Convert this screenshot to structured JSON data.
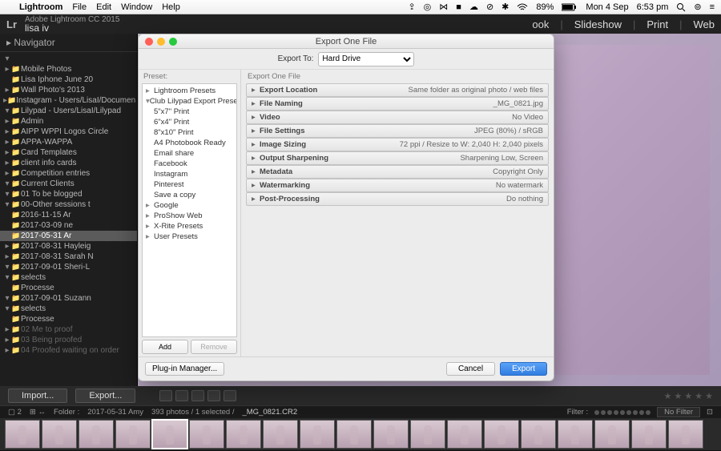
{
  "menubar": {
    "apple": "",
    "app": "Lightroom",
    "items": [
      "File",
      "Edit",
      "Window",
      "Help"
    ],
    "right": {
      "icons": [
        "⇪",
        "◎",
        "⋈",
        "■",
        "☁",
        "⊘",
        "✱",
        "⋮",
        "ᚼ"
      ],
      "wifi": "",
      "battery_pct": "89%",
      "day": "Mon 4 Sep",
      "time": "6:53 pm"
    }
  },
  "lr": {
    "version": "Adobe Lightroom CC 2015",
    "user": "lisa iv",
    "logo": "Lr",
    "modules": [
      "ook",
      "Slideshow",
      "Print",
      "Web"
    ]
  },
  "navigator_label": "Navigator",
  "tree": [
    {
      "ind": 1,
      "tri": "▾",
      "fold": "",
      "label": "",
      "dim": true
    },
    {
      "ind": 2,
      "tri": "▸",
      "fold": "📁",
      "label": "Mobile Photos"
    },
    {
      "ind": 3,
      "tri": "",
      "fold": "📁",
      "label": "Lisa Iphone June 20"
    },
    {
      "ind": 2,
      "tri": "▸",
      "fold": "📁",
      "label": "Wall Photo's 2013"
    },
    {
      "ind": 1,
      "tri": "▸",
      "fold": "📁",
      "label": "Instagram - Users/LisaI/Documen"
    },
    {
      "ind": 1,
      "tri": "▾",
      "fold": "📁",
      "label": "Lilypad - Users/LisaI/Lilypad"
    },
    {
      "ind": 2,
      "tri": "▸",
      "fold": "📁",
      "label": "Admin"
    },
    {
      "ind": 2,
      "tri": "▸",
      "fold": "📁",
      "label": "AIPP WPPI Logos Circle"
    },
    {
      "ind": 2,
      "tri": "▸",
      "fold": "📁",
      "label": "APPA-WAPPA"
    },
    {
      "ind": 2,
      "tri": "▸",
      "fold": "📁",
      "label": "Card Templates"
    },
    {
      "ind": 2,
      "tri": "▸",
      "fold": "📁",
      "label": "client info cards"
    },
    {
      "ind": 2,
      "tri": "▸",
      "fold": "📁",
      "label": "Competition entries"
    },
    {
      "ind": 2,
      "tri": "▾",
      "fold": "📁",
      "label": "Current Clients"
    },
    {
      "ind": 3,
      "tri": "▾",
      "fold": "📁",
      "label": "01 To be blogged"
    },
    {
      "ind": 4,
      "tri": "▾",
      "fold": "📁",
      "label": "00-Other sessions t"
    },
    {
      "ind": 5,
      "tri": "",
      "fold": "📁",
      "label": "2016-11-15 Ar"
    },
    {
      "ind": 5,
      "tri": "",
      "fold": "📁",
      "label": "2017-03-09 ne"
    },
    {
      "ind": 5,
      "tri": "",
      "fold": "📁",
      "label": "2017-05-31 Ar",
      "sel": true
    },
    {
      "ind": 4,
      "tri": "▸",
      "fold": "📁",
      "label": "2017-08-31 Hayleig"
    },
    {
      "ind": 4,
      "tri": "▸",
      "fold": "📁",
      "label": "2017-08-31 Sarah N"
    },
    {
      "ind": 4,
      "tri": "▾",
      "fold": "📁",
      "label": "2017-09-01 Sheri-L"
    },
    {
      "ind": 5,
      "tri": "▾",
      "fold": "📁",
      "label": "selects"
    },
    {
      "ind": 6,
      "tri": "",
      "fold": "📁",
      "label": "Processe"
    },
    {
      "ind": 4,
      "tri": "▾",
      "fold": "📁",
      "label": "2017-09-01 Suzann"
    },
    {
      "ind": 5,
      "tri": "▾",
      "fold": "📁",
      "label": "selects"
    },
    {
      "ind": 6,
      "tri": "",
      "fold": "📁",
      "label": "Processe"
    },
    {
      "ind": 3,
      "tri": "▸",
      "fold": "📁",
      "label": "02 Me to proof",
      "dim": true
    },
    {
      "ind": 3,
      "tri": "▸",
      "fold": "📁",
      "label": "03 Being proofed",
      "dim": true
    },
    {
      "ind": 3,
      "tri": "▸",
      "fold": "📁",
      "label": "04 Proofed waiting on order",
      "dim": true
    }
  ],
  "bottom": {
    "import": "Import...",
    "export": "Export..."
  },
  "pathbar": {
    "folder_label": "Folder :",
    "folder": "2017-05-31 Amy",
    "count": "393 photos / 1 selected /",
    "file": "_MG_0821.CR2",
    "filter_label": "Filter :",
    "nofilter": "No Filter"
  },
  "dialog": {
    "title": "Export One File",
    "export_to_label": "Export To:",
    "export_to_value": "Hard Drive",
    "preset_label": "Preset:",
    "export_one_label": "Export One File",
    "presets": [
      {
        "ind": 0,
        "tri": "▸",
        "label": "Lightroom Presets"
      },
      {
        "ind": 0,
        "tri": "▾",
        "label": "Club Lilypad Export Presets"
      },
      {
        "ind": 1,
        "tri": "",
        "label": "5\"x7\" Print"
      },
      {
        "ind": 1,
        "tri": "",
        "label": "6\"x4\" Print"
      },
      {
        "ind": 1,
        "tri": "",
        "label": "8\"x10\" Print"
      },
      {
        "ind": 1,
        "tri": "",
        "label": "A4 Photobook Ready"
      },
      {
        "ind": 1,
        "tri": "",
        "label": "Email share"
      },
      {
        "ind": 1,
        "tri": "",
        "label": "Facebook"
      },
      {
        "ind": 1,
        "tri": "",
        "label": "Instagram"
      },
      {
        "ind": 1,
        "tri": "",
        "label": "Pinterest"
      },
      {
        "ind": 1,
        "tri": "",
        "label": "Save a copy"
      },
      {
        "ind": 0,
        "tri": "▸",
        "label": "Google"
      },
      {
        "ind": 0,
        "tri": "▸",
        "label": "ProShow Web"
      },
      {
        "ind": 0,
        "tri": "▸",
        "label": "X-Rite Presets"
      },
      {
        "ind": 0,
        "tri": "▸",
        "label": "User Presets"
      }
    ],
    "add": "Add",
    "remove": "Remove",
    "sections": [
      {
        "name": "Export Location",
        "val": "Same folder as original photo / web files"
      },
      {
        "name": "File Naming",
        "val": "_MG_0821.jpg"
      },
      {
        "name": "Video",
        "val": "No Video"
      },
      {
        "name": "File Settings",
        "val": "JPEG (80%) / sRGB"
      },
      {
        "name": "Image Sizing",
        "val": "72 ppi / Resize to W: 2,040 H: 2,040 pixels"
      },
      {
        "name": "Output Sharpening",
        "val": "Sharpening Low, Screen"
      },
      {
        "name": "Metadata",
        "val": "Copyright Only"
      },
      {
        "name": "Watermarking",
        "val": "No watermark"
      },
      {
        "name": "Post-Processing",
        "val": "Do nothing"
      }
    ],
    "plugin": "Plug-in Manager...",
    "cancel": "Cancel",
    "export": "Export"
  }
}
